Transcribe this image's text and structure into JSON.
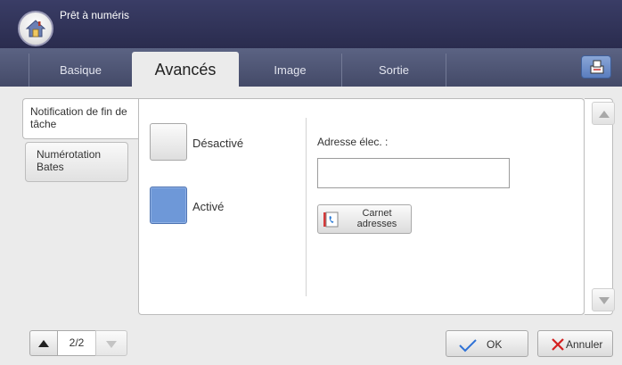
{
  "header": {
    "status_text": "Prêt à numéris",
    "home_icon": "home-icon"
  },
  "tabs": [
    {
      "label": "Basique",
      "active": false
    },
    {
      "label": "Avancés",
      "active": true
    },
    {
      "label": "Image",
      "active": false
    },
    {
      "label": "Sortie",
      "active": false
    }
  ],
  "toolbar": {
    "extra_icon": "job-status-icon"
  },
  "subtabs": [
    {
      "label": "Notification de fin de tâche",
      "active": true
    },
    {
      "label": "Numérotation Bates",
      "active": false
    }
  ],
  "options": {
    "off_label": "Désactivé",
    "on_label": "Activé",
    "selected": "Activé"
  },
  "email": {
    "label": "Adresse élec. :",
    "value": "",
    "placeholder": ""
  },
  "address_book": {
    "label": "Carnet adresses",
    "icon": "address-book-icon"
  },
  "pagination": {
    "text": "2/2"
  },
  "actions": {
    "ok_label": "OK",
    "cancel_label": "Annuler"
  },
  "colors": {
    "header": "#2d2f52",
    "tabbar": "#4f5676",
    "selected_option": "#6e98d8",
    "ok_check": "#2f72d6",
    "cancel_x": "#d42020"
  }
}
